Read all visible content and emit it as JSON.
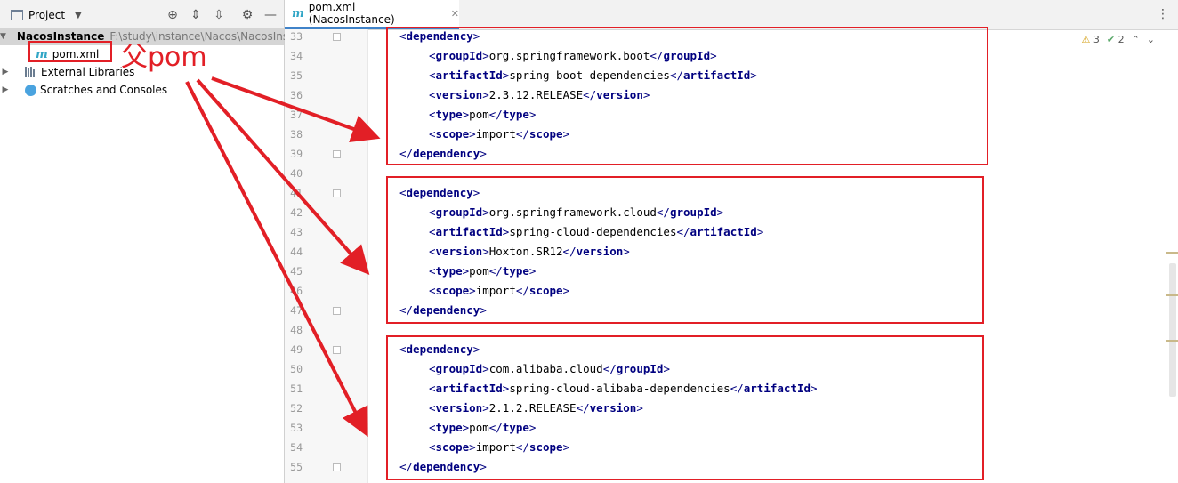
{
  "project_panel": {
    "title": "Project",
    "tree": {
      "root_name": "NacosInstance",
      "root_path": "F:\\study\\instance\\Nacos\\NacosInstance",
      "pom_file": "pom.xml",
      "external_libraries": "External Libraries",
      "scratches": "Scratches and Consoles"
    }
  },
  "annotation": "父pom",
  "editor": {
    "tab_label": "pom.xml (NacosInstance)",
    "inspections": {
      "warnings": "3",
      "ok": "2"
    },
    "line_numbers": [
      "33",
      "34",
      "35",
      "36",
      "37",
      "38",
      "39",
      "40",
      "41",
      "42",
      "43",
      "44",
      "45",
      "46",
      "47",
      "48",
      "49",
      "50",
      "51",
      "52",
      "53",
      "54",
      "55"
    ],
    "blocks": [
      {
        "groupId": "org.springframework.boot",
        "artifactId": "spring-boot-dependencies",
        "version": "2.3.12.RELEASE",
        "type": "pom",
        "scope": "import"
      },
      {
        "groupId": "org.springframework.cloud",
        "artifactId": "spring-cloud-dependencies",
        "version": "Hoxton.SR12",
        "type": "pom",
        "scope": "import"
      },
      {
        "groupId": "com.alibaba.cloud",
        "artifactId": "spring-cloud-alibaba-dependencies",
        "version": "2.1.2.RELEASE",
        "type": "pom",
        "scope": "import"
      }
    ]
  },
  "colors": {
    "annotation_red": "#e21f26",
    "tag_blue": "#000080",
    "tab_accent": "#4083c9"
  }
}
